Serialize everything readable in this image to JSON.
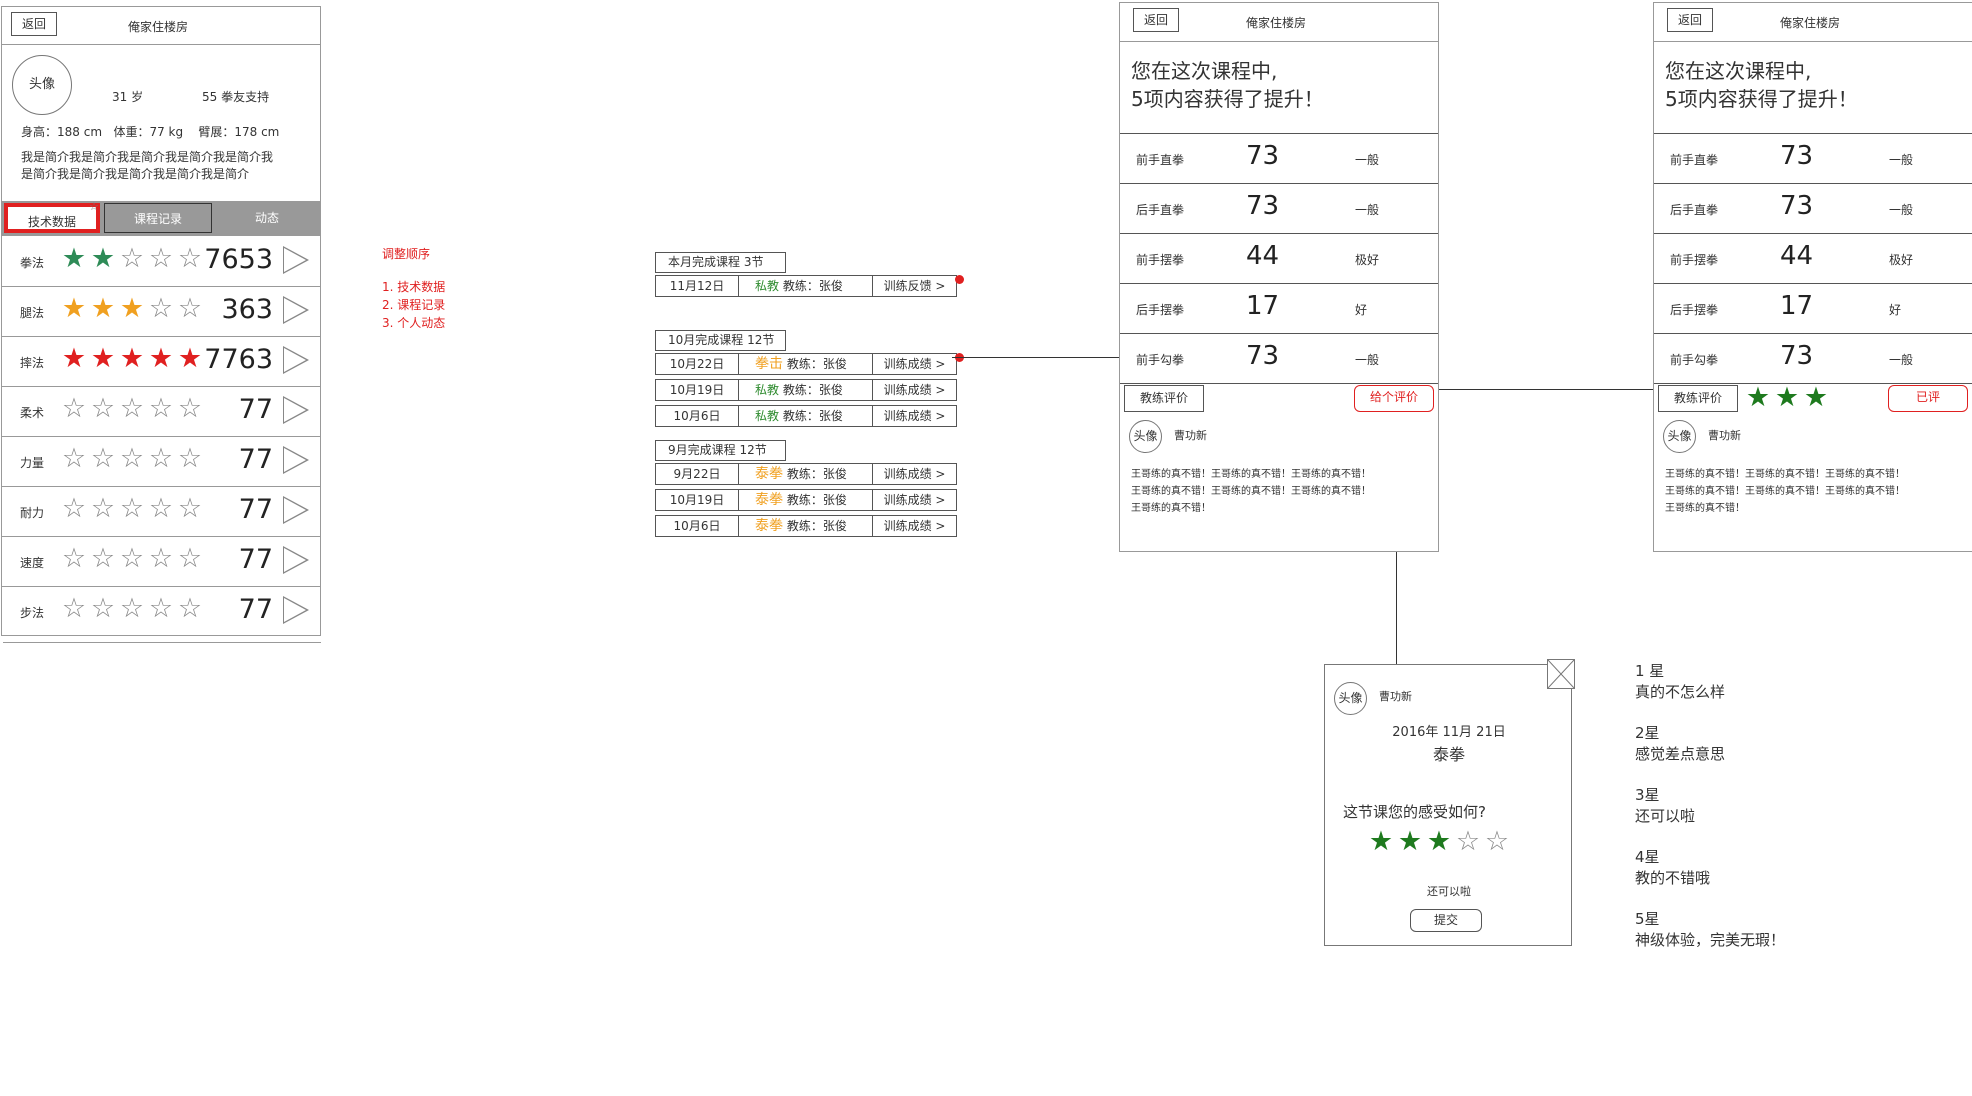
{
  "profile_screen": {
    "back_label": "返回",
    "title": "俺家住楼房",
    "avatar_label": "头像",
    "age": "31 岁",
    "supporters": "55 拳友支持",
    "stats_line": "身高：188 cm   体重：77 kg    臂展：178 cm",
    "bio_line1": "我是简介我是简介我是简介我是简介我是简介我",
    "bio_line2": "是简介我是简介我是简介我是简介我是简介",
    "tabs": [
      "技术数据",
      "课程记录",
      "动态"
    ],
    "skills": [
      {
        "label": "拳法",
        "stars": 2,
        "star_color": "#2e8b57",
        "value": "7653"
      },
      {
        "label": "腿法",
        "stars": 3,
        "star_color": "#f0a020",
        "value": "363"
      },
      {
        "label": "摔法",
        "stars": 5,
        "star_color": "#e02020",
        "value": "7763"
      },
      {
        "label": "柔术",
        "stars": 0,
        "star_color": "#888888",
        "value": "77"
      },
      {
        "label": "力量",
        "stars": 0,
        "star_color": "#888888",
        "value": "77"
      },
      {
        "label": "耐力",
        "stars": 0,
        "star_color": "#888888",
        "value": "77"
      },
      {
        "label": "速度",
        "stars": 0,
        "star_color": "#888888",
        "value": "77"
      },
      {
        "label": "步法",
        "stars": 0,
        "star_color": "#888888",
        "value": "77"
      }
    ]
  },
  "order_note": {
    "title": "调整顺序",
    "items": [
      "1. 技术数据",
      "2. 课程记录",
      "3. 个人动态"
    ]
  },
  "course_groups": [
    {
      "header": "本月完成课程 3节",
      "rows": [
        {
          "date": "11月12日",
          "type": "私教",
          "type_color": "#2e8b2e",
          "coach": "教练：张俊",
          "action": "训练反馈 >"
        }
      ]
    },
    {
      "header": "10月完成课程 12节",
      "rows": [
        {
          "date": "10月22日",
          "type": "拳击",
          "type_color": "#f0a020",
          "coach": "教练：张俊",
          "action": "训练成绩 >"
        },
        {
          "date": "10月19日",
          "type": "私教",
          "type_color": "#2e8b2e",
          "coach": "教练：张俊",
          "action": "训练成绩 >"
        },
        {
          "date": "10月6日",
          "type": "私教",
          "type_color": "#2e8b2e",
          "coach": "教练：张俊",
          "action": "训练成绩 >"
        }
      ]
    },
    {
      "header": "9月完成课程 12节",
      "rows": [
        {
          "date": "9月22日",
          "type": "泰拳",
          "type_color": "#f0a020",
          "coach": "教练：张俊",
          "action": "训练成绩 >"
        },
        {
          "date": "10月19日",
          "type": "泰拳",
          "type_color": "#f0a020",
          "coach": "教练：张俊",
          "action": "训练成绩 >"
        },
        {
          "date": "10月6日",
          "type": "泰拳",
          "type_color": "#f0a020",
          "coach": "教练：张俊",
          "action": "训练成绩 >"
        }
      ]
    }
  ],
  "result_screen_a": {
    "back_label": "返回",
    "title": "俺家住楼房",
    "headline1": "您在这次课程中,",
    "headline2": "5项内容获得了提升！",
    "rows": [
      {
        "label": "前手直拳",
        "value": "73",
        "grade": "一般"
      },
      {
        "label": "后手直拳",
        "value": "73",
        "grade": "一般"
      },
      {
        "label": "前手摆拳",
        "value": "44",
        "grade": "极好"
      },
      {
        "label": "后手摆拳",
        "value": "17",
        "grade": "好"
      },
      {
        "label": "前手勾拳",
        "value": "73",
        "grade": "一般"
      }
    ],
    "coach_eval_label": "教练评价",
    "rate_button": "给个评价",
    "avatar_label": "头像",
    "coach_name": "曹功新",
    "comment": [
      "王哥练的真不错！王哥练的真不错！王哥练的真不错！",
      "王哥练的真不错！王哥练的真不错！王哥练的真不错！",
      "王哥练的真不错！"
    ]
  },
  "result_screen_b": {
    "back_label": "返回",
    "title": "俺家住楼房",
    "headline1": "您在这次课程中,",
    "headline2": "5项内容获得了提升！",
    "rows": [
      {
        "label": "前手直拳",
        "value": "73",
        "grade": "一般"
      },
      {
        "label": "后手直拳",
        "value": "73",
        "grade": "一般"
      },
      {
        "label": "前手摆拳",
        "value": "44",
        "grade": "极好"
      },
      {
        "label": "后手摆拳",
        "value": "17",
        "grade": "好"
      },
      {
        "label": "前手勾拳",
        "value": "73",
        "grade": "一般"
      }
    ],
    "coach_eval_label": "教练评价",
    "rating_stars": 3,
    "rated_label": "已评",
    "avatar_label": "头像",
    "coach_name": "曹功新",
    "comment": [
      "王哥练的真不错！王哥练的真不错！王哥练的真不错！",
      "王哥练的真不错！王哥练的真不错！王哥练的真不错！",
      "王哥练的真不错！"
    ]
  },
  "rating_dialog": {
    "avatar_label": "头像",
    "coach_name": "曹功新",
    "date": "2016年 11月 21日",
    "course": "泰拳",
    "question": "这节课您的感受如何?",
    "rating": 3,
    "rating_text": "还可以啦",
    "submit_label": "提交"
  },
  "star_legend": [
    {
      "level": "1 星",
      "text": "真的不怎么样"
    },
    {
      "level": "2星",
      "text": "感觉差点意思"
    },
    {
      "level": "3星",
      "text": "还可以啦"
    },
    {
      "level": "4星",
      "text": "教的不错哦"
    },
    {
      "level": "5星",
      "text": "神级体验，完美无瑕！"
    }
  ],
  "colors": {
    "accent_red": "#e02020",
    "green": "#2e8b2e",
    "orange": "#f0a020",
    "border": "#999999"
  }
}
